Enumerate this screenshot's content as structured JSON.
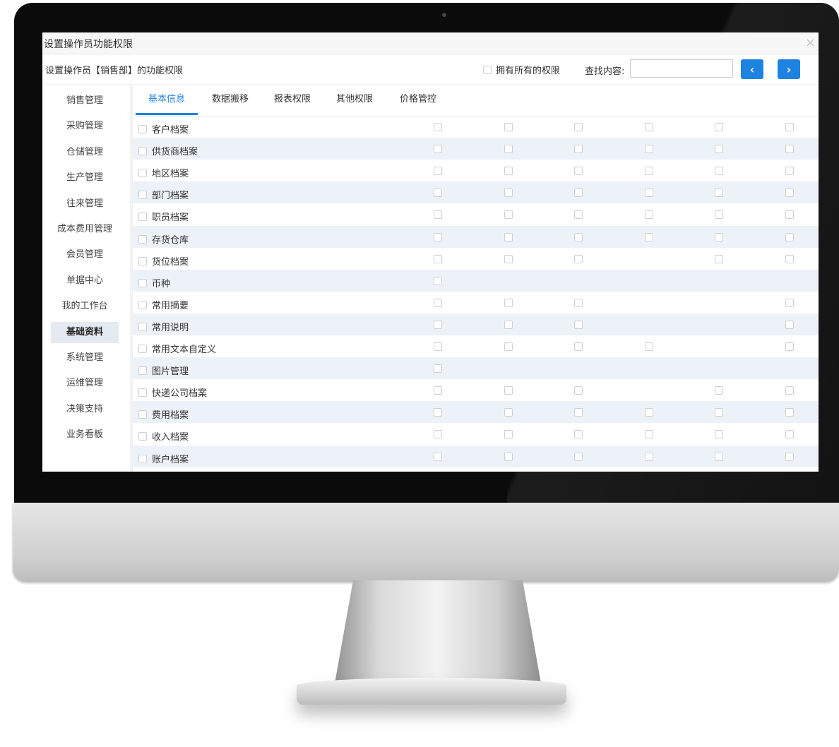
{
  "window": {
    "title": "设置操作员功能权限",
    "close_glyph": "×"
  },
  "toolbar": {
    "heading": "设置操作员【销售部】的功能权限",
    "all_permissions_label": "拥有所有的权限",
    "search_label": "查找内容:",
    "search_value": "",
    "prev_glyph": "‹",
    "next_glyph": "›"
  },
  "sidebar": {
    "items": [
      {
        "label": "销售管理"
      },
      {
        "label": "采购管理"
      },
      {
        "label": "仓储管理"
      },
      {
        "label": "生产管理"
      },
      {
        "label": "往来管理"
      },
      {
        "label": "成本费用管理"
      },
      {
        "label": "会员管理"
      },
      {
        "label": "单据中心"
      },
      {
        "label": "我的工作台"
      },
      {
        "label": "基础资料",
        "active": true
      },
      {
        "label": "系统管理"
      },
      {
        "label": "运维管理"
      },
      {
        "label": "决策支持"
      },
      {
        "label": "业务看板"
      }
    ]
  },
  "tabs": [
    {
      "label": "基本信息",
      "active": true
    },
    {
      "label": "数据搬移"
    },
    {
      "label": "报表权限"
    },
    {
      "label": "其他权限"
    },
    {
      "label": "价格管控"
    }
  ],
  "permission_rows": [
    {
      "name": "客户档案",
      "cols": [
        true,
        true,
        true,
        true,
        true,
        true
      ]
    },
    {
      "name": "供货商档案",
      "cols": [
        true,
        true,
        true,
        true,
        true,
        true
      ]
    },
    {
      "name": "地区档案",
      "cols": [
        true,
        true,
        true,
        true,
        true,
        true
      ]
    },
    {
      "name": "部门档案",
      "cols": [
        true,
        true,
        true,
        true,
        true,
        true
      ]
    },
    {
      "name": "职员档案",
      "cols": [
        true,
        true,
        true,
        true,
        true,
        true
      ]
    },
    {
      "name": "存货仓库",
      "cols": [
        true,
        true,
        true,
        true,
        true,
        true
      ]
    },
    {
      "name": "货位档案",
      "cols": [
        true,
        true,
        true,
        false,
        true,
        true
      ]
    },
    {
      "name": "币种",
      "cols": [
        true,
        false,
        false,
        false,
        false,
        false
      ]
    },
    {
      "name": "常用摘要",
      "cols": [
        true,
        true,
        true,
        false,
        false,
        true
      ]
    },
    {
      "name": "常用说明",
      "cols": [
        true,
        true,
        true,
        false,
        false,
        true
      ]
    },
    {
      "name": "常用文本自定义",
      "cols": [
        true,
        true,
        true,
        true,
        false,
        true
      ]
    },
    {
      "name": "图片管理",
      "cols": [
        true,
        false,
        false,
        false,
        false,
        false
      ]
    },
    {
      "name": "快递公司档案",
      "cols": [
        true,
        true,
        true,
        false,
        true,
        true
      ]
    },
    {
      "name": "费用档案",
      "cols": [
        true,
        true,
        true,
        true,
        true,
        true
      ]
    },
    {
      "name": "收入档案",
      "cols": [
        true,
        true,
        true,
        true,
        true,
        true
      ]
    },
    {
      "name": "账户档案",
      "cols": [
        true,
        true,
        true,
        true,
        true,
        true
      ]
    }
  ]
}
